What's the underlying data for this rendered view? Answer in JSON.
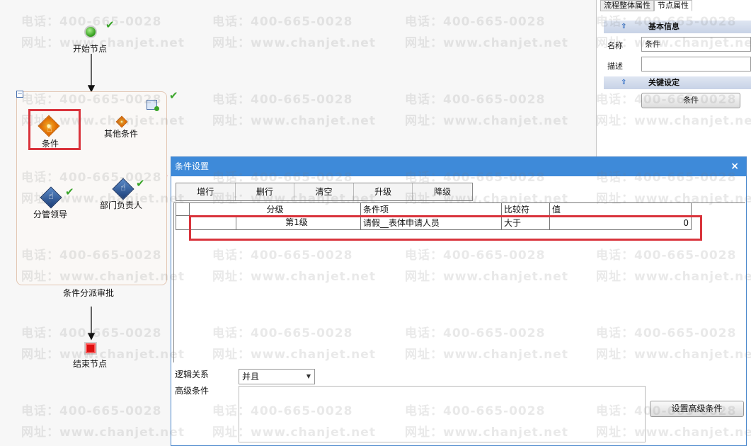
{
  "workflow": {
    "start_label": "开始节点",
    "condition_label": "条件",
    "other_condition_label": "其他条件",
    "branch_a_label": "分管领导",
    "branch_b_label": "部门负责人",
    "container_label": "条件分派审批",
    "end_label": "结束节点"
  },
  "property_panel": {
    "tabs": [
      "流程整体属性",
      "节点属性"
    ],
    "active_tab": 1,
    "section_basic": "基本信息",
    "name_label": "名称",
    "name_value": "条件",
    "desc_label": "描述",
    "desc_value": "",
    "section_key": "关键设定",
    "condition_button": "条件"
  },
  "dialog": {
    "title": "条件设置",
    "close_symbol": "×",
    "toolbar": [
      "增行",
      "删行",
      "清空",
      "升级",
      "降级"
    ],
    "columns": [
      "分级",
      "条件项",
      "比较符",
      "值"
    ],
    "rows": [
      {
        "level": "第1级",
        "item": "请假__表体申请人员",
        "operator": "大于",
        "value": "0"
      }
    ],
    "logic_label": "逻辑关系",
    "logic_value": "并且",
    "advanced_label": "高级条件",
    "advanced_button": "设置高级条件"
  },
  "watermark": {
    "phone": "电话：400-665-0028",
    "site": "网址：www.chanjet.net"
  },
  "colors": {
    "dialog_title_bar": "#3e8ad9",
    "highlight_red": "#d9333b",
    "check_green": "#3aa52a",
    "flow_link": "#6a6ad0"
  }
}
